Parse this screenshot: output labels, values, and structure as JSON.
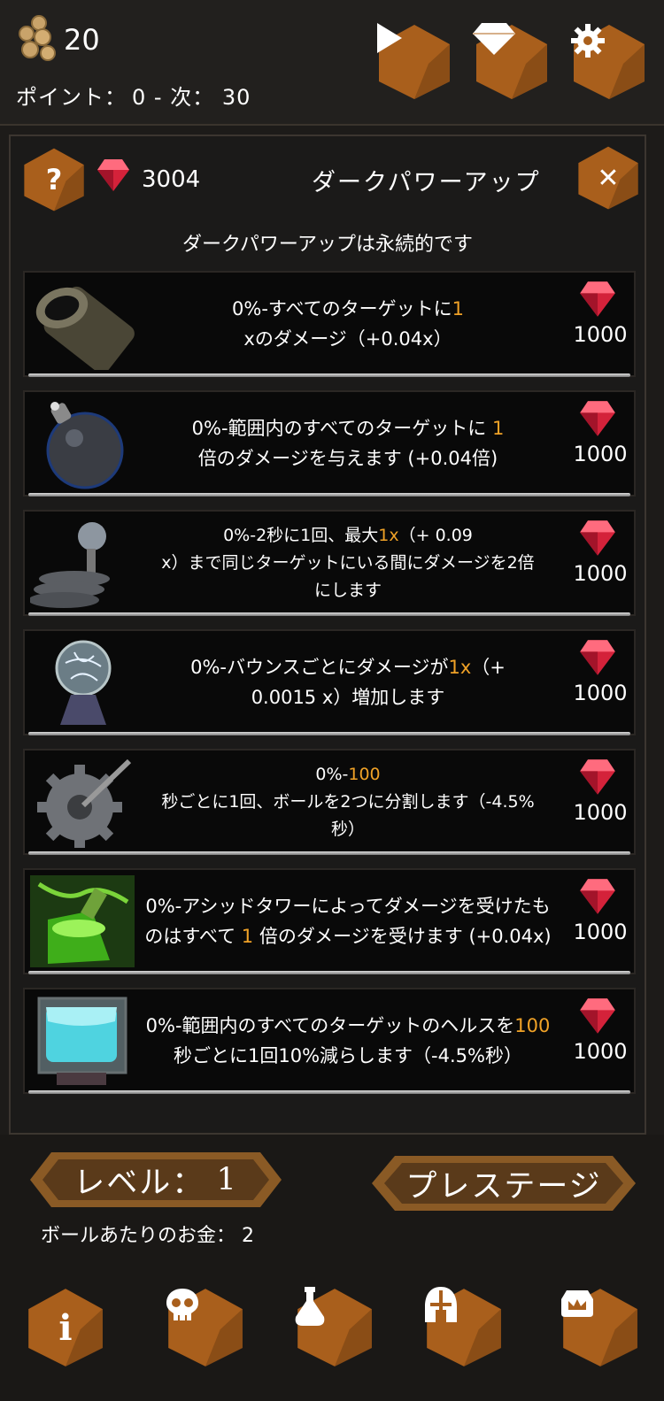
{
  "header": {
    "coins": "20",
    "points_label": "ポイント：",
    "points_value": "0 - 次： 30",
    "play_icon": "play-icon",
    "diamond_icon": "diamond-icon",
    "settings_icon": "gear-icon"
  },
  "panel": {
    "gems": "3004",
    "title": "ダークパワーアップ",
    "subtitle": "ダークパワーアップは永続的です"
  },
  "upgrades": [
    {
      "icon": "cannon-icon",
      "line1a": "0%-すべてのターゲットに",
      "line1b": "1",
      "line2": "xのダメージ（+0.04x）",
      "cost": "1000"
    },
    {
      "icon": "bomb-icon",
      "line1a": "0%-範囲内のすべてのターゲットに ",
      "line1b": "1",
      "line2": "倍のダメージを与えます (+0.04倍)",
      "cost": "1000"
    },
    {
      "icon": "tesla-coil-icon",
      "line1a": "0%-2秒に1回、最大",
      "line1b": "1x",
      "line1c": "（+ 0.09",
      "line2": "x）まで同じターゲットにいる間にダメージを2倍",
      "line3": "にします",
      "cost": "1000"
    },
    {
      "icon": "plasma-orb-icon",
      "line1a": "0%-バウンスごとにダメージが",
      "line1b": "1x",
      "line1c": "（+",
      "line2": "0.0015 x）増加します",
      "cost": "1000"
    },
    {
      "icon": "saw-blade-icon",
      "line1a": "0%-",
      "line1b": "100",
      "line2": "秒ごとに1回、ボールを2つに分割します（-4.5%",
      "line3": "秒）",
      "cost": "1000"
    },
    {
      "icon": "acid-flask-icon",
      "line1a": "0%-アシッドタワーによってダメージを受けたも",
      "line2a": "のはすべて ",
      "line2b": "1",
      "line2c": " 倍のダメージを受けます (+0.04x)",
      "cost": "1000"
    },
    {
      "icon": "ice-cube-icon",
      "line1a": "0%-範囲内のすべてのターゲットのヘルスを",
      "line1b": "100",
      "line2": "秒ごとに1回10%減らします（-4.5%秒）",
      "cost": "1000"
    }
  ],
  "footer": {
    "level_label": "レベル：",
    "level_value": "1",
    "prestige": "プレステージ",
    "money_label": "ボールあたりのお金：",
    "money_value": "2",
    "nav": [
      "info-icon",
      "skull-icon",
      "potion-icon",
      "helmet-icon",
      "crown-icon"
    ]
  },
  "colors": {
    "accent": "#f0a227",
    "hex_button": "#a95f1c",
    "hex_shadow": "#5b3410"
  }
}
